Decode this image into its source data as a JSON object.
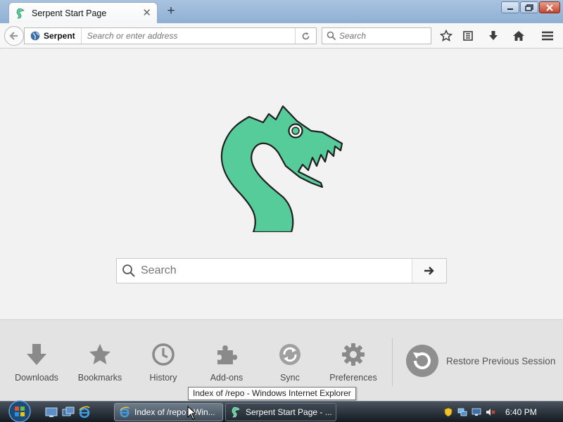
{
  "browser": {
    "tab_title": "Serpent Start Page",
    "newtab_label": "+",
    "identity_label": "Serpent",
    "url_placeholder": "Search or enter address",
    "search_placeholder": "Search"
  },
  "window_controls": {
    "minimize_icon": "minimize-icon",
    "maximize_icon": "restore-icon",
    "close_icon": "close-icon"
  },
  "toolbar_icons": [
    "bookmark-star-icon",
    "reading-list-icon",
    "downloads-icon",
    "home-icon",
    "menu-icon"
  ],
  "start_page": {
    "search_placeholder": "Search",
    "logo_color": "#55cc99",
    "launcher": [
      {
        "label": "Downloads",
        "icon": "download-arrow-icon"
      },
      {
        "label": "Bookmarks",
        "icon": "star-icon"
      },
      {
        "label": "History",
        "icon": "clock-icon"
      },
      {
        "label": "Add-ons",
        "icon": "puzzle-icon"
      },
      {
        "label": "Sync",
        "icon": "sync-icon"
      },
      {
        "label": "Preferences",
        "icon": "gear-icon"
      }
    ],
    "restore_label": "Restore Previous Session"
  },
  "tooltip": "Index of /repo - Windows Internet Explorer",
  "taskbar": {
    "buttons": [
      {
        "label": "Index of /repo - Win...",
        "icon": "ie-icon"
      },
      {
        "label": "Serpent Start Page - ...",
        "icon": "serpent-icon"
      }
    ],
    "clock": "6:40 PM"
  },
  "colors": {
    "accent_green": "#55cc99",
    "taskbar_dark": "#1b2229",
    "launcher_icon_gray": "#8a8a8a"
  }
}
